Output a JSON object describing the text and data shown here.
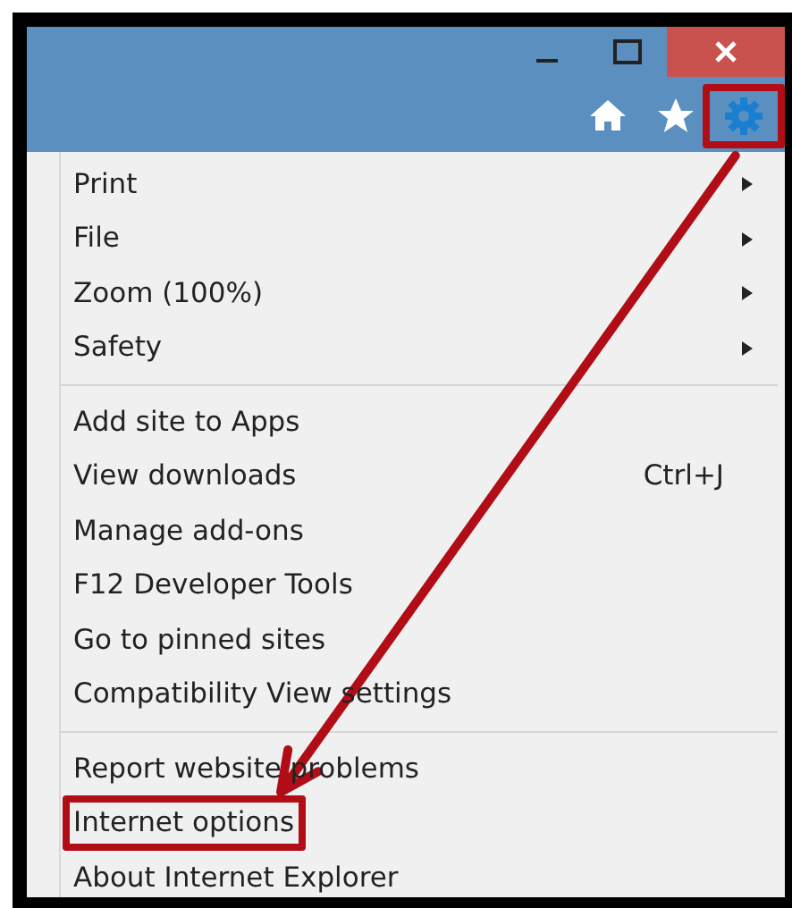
{
  "toolbar": {
    "buttons": [
      {
        "kind": "home",
        "highlighted": false
      },
      {
        "kind": "favorites",
        "highlighted": false
      },
      {
        "kind": "tools",
        "highlighted": true
      }
    ]
  },
  "menu": {
    "groups": [
      [
        {
          "label": "Print",
          "kind": "submenu",
          "highlighted": false
        },
        {
          "label": "File",
          "kind": "submenu",
          "highlighted": false
        },
        {
          "label": "Zoom (100%)",
          "kind": "submenu",
          "highlighted": false
        },
        {
          "label": "Safety",
          "kind": "submenu",
          "highlighted": false
        }
      ],
      [
        {
          "label": "Add site to Apps",
          "kind": "plain",
          "highlighted": false
        },
        {
          "label": "View downloads",
          "kind": "shortcut",
          "shortcut": "Ctrl+J",
          "highlighted": false
        },
        {
          "label": "Manage add-ons",
          "kind": "plain",
          "highlighted": false
        },
        {
          "label": "F12 Developer Tools",
          "kind": "plain",
          "highlighted": false
        },
        {
          "label": "Go to pinned sites",
          "kind": "plain",
          "highlighted": false
        },
        {
          "label": "Compatibility View settings",
          "kind": "plain",
          "highlighted": false
        }
      ],
      [
        {
          "label": "Report website problems",
          "kind": "plain",
          "highlighted": false
        },
        {
          "label": "Internet options",
          "kind": "plain",
          "highlighted": true
        },
        {
          "label": "About Internet Explorer",
          "kind": "plain",
          "highlighted": false
        }
      ]
    ]
  }
}
